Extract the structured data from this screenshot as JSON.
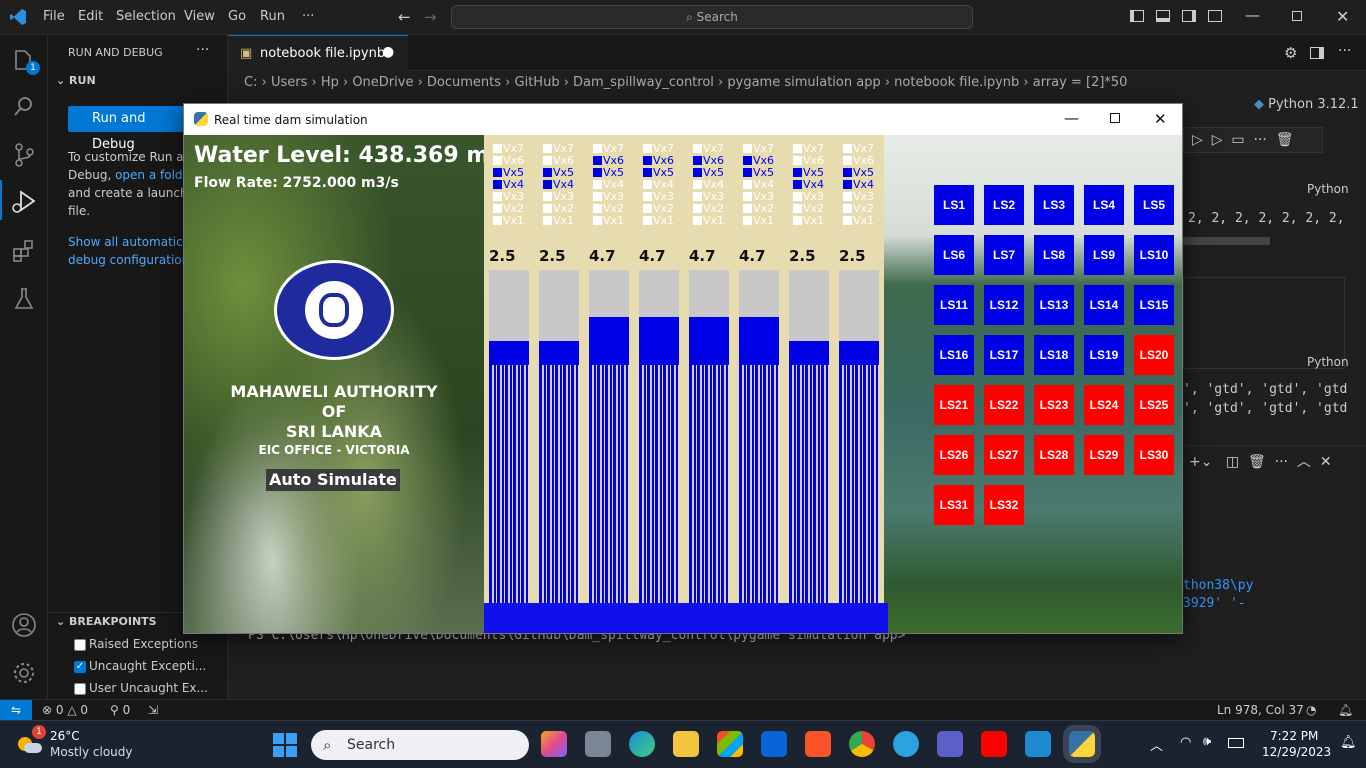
{
  "menu": {
    "file": "File",
    "edit": "Edit",
    "selection": "Selection",
    "view": "View",
    "go": "Go",
    "run": "Run",
    "more": "···",
    "search": "Search"
  },
  "sidebar": {
    "title": "RUN AND DEBUG",
    "section_run": "RUN",
    "run_button": "Run and Debug",
    "help_l1": "To customize Run ar",
    "help_l2a": "Debug, ",
    "help_l2_link": "open a folde",
    "help_l3": "and create a launch.",
    "help_l4": "file.",
    "show_all_l1": "Show all automatic",
    "show_all_l2": "debug configuration",
    "breakpoints": "BREAKPOINTS",
    "bp_items": [
      {
        "label": "Raised Exceptions",
        "checked": false
      },
      {
        "label": "Uncaught Excepti...",
        "checked": true
      },
      {
        "label": "User Uncaught Ex...",
        "checked": false
      }
    ]
  },
  "editor": {
    "tab_label": "notebook file.ipynb",
    "breadcrumb": [
      "C:",
      "Users",
      "Hp",
      "OneDrive",
      "Documents",
      "GitHub",
      "Dam_spillway_control",
      "pygame simulation app",
      "notebook file.ipynb",
      "array = [2]*50"
    ],
    "kernel": "Python 3.12.1",
    "cell_lang1": "Python",
    "output_row": "2, 2, 2, 2, 2, 2, 2,",
    "cell_lang2": "Python",
    "gtd_row1": "', 'gtd', 'gtd', 'gtd",
    "gtd_row2": "', 'gtd', 'gtd', 'gtd",
    "term_r1": "thon38\\py",
    "term_r2": "3929' '-",
    "prompt": "PS C:\\Users\\Hp\\OneDrive\\Documents\\GitHub\\Dam_spillway_control\\pygame simulation app>"
  },
  "status": {
    "errors": "0",
    "warnings": "0",
    "ports": "0",
    "cursor": "Ln 978, Col 37"
  },
  "taskbar": {
    "temp": "26°C",
    "weather": "Mostly cloudy",
    "badge": "1",
    "search": "Search",
    "time": "7:22 PM",
    "date": "12/29/2023"
  },
  "sim": {
    "window_title": "Real time dam simulation",
    "water_level": "Water Level: 438.369 m",
    "flow_rate": "Flow Rate: 2752.000 m3/s",
    "org_l1": "MAHAWELI AUTHORITY",
    "org_l2": "OF",
    "org_l3": "SRI LANKA",
    "org_l4": "EIC OFFICE - VICTORIA",
    "auto_button": "Auto Simulate",
    "gates": [
      {
        "opening": "2.5",
        "level": 2,
        "vx": [
          false,
          false,
          true,
          true,
          false,
          false,
          false
        ]
      },
      {
        "opening": "2.5",
        "level": 2,
        "vx": [
          false,
          false,
          true,
          true,
          false,
          false,
          false
        ]
      },
      {
        "opening": "4.7",
        "level": 4,
        "vx": [
          false,
          true,
          true,
          false,
          false,
          false,
          false
        ]
      },
      {
        "opening": "4.7",
        "level": 4,
        "vx": [
          false,
          true,
          true,
          false,
          false,
          false,
          false
        ]
      },
      {
        "opening": "4.7",
        "level": 4,
        "vx": [
          false,
          true,
          true,
          false,
          false,
          false,
          false
        ]
      },
      {
        "opening": "4.7",
        "level": 4,
        "vx": [
          false,
          true,
          true,
          false,
          false,
          false,
          false
        ]
      },
      {
        "opening": "2.5",
        "level": 2,
        "vx": [
          false,
          false,
          true,
          true,
          false,
          false,
          false
        ]
      },
      {
        "opening": "2.5",
        "level": 2,
        "vx": [
          false,
          false,
          true,
          true,
          false,
          false,
          false
        ]
      }
    ],
    "vx_labels": [
      "Vx7",
      "Vx6",
      "Vx5",
      "Vx4",
      "Vx3",
      "Vx2",
      "Vx1"
    ],
    "ls": [
      {
        "label": "LS1",
        "state": "blue"
      },
      {
        "label": "LS2",
        "state": "blue"
      },
      {
        "label": "LS3",
        "state": "blue"
      },
      {
        "label": "LS4",
        "state": "blue"
      },
      {
        "label": "LS5",
        "state": "blue"
      },
      {
        "label": "LS6",
        "state": "blue"
      },
      {
        "label": "LS7",
        "state": "blue"
      },
      {
        "label": "LS8",
        "state": "blue"
      },
      {
        "label": "LS9",
        "state": "blue"
      },
      {
        "label": "LS10",
        "state": "blue"
      },
      {
        "label": "LS11",
        "state": "blue"
      },
      {
        "label": "LS12",
        "state": "blue"
      },
      {
        "label": "LS13",
        "state": "blue"
      },
      {
        "label": "LS14",
        "state": "blue"
      },
      {
        "label": "LS15",
        "state": "blue"
      },
      {
        "label": "LS16",
        "state": "blue"
      },
      {
        "label": "LS17",
        "state": "blue"
      },
      {
        "label": "LS18",
        "state": "blue"
      },
      {
        "label": "LS19",
        "state": "blue"
      },
      {
        "label": "LS20",
        "state": "red"
      },
      {
        "label": "LS21",
        "state": "red"
      },
      {
        "label": "LS22",
        "state": "red"
      },
      {
        "label": "LS23",
        "state": "red"
      },
      {
        "label": "LS24",
        "state": "red"
      },
      {
        "label": "LS25",
        "state": "red"
      },
      {
        "label": "LS26",
        "state": "red"
      },
      {
        "label": "LS27",
        "state": "red"
      },
      {
        "label": "LS28",
        "state": "red"
      },
      {
        "label": "LS29",
        "state": "red"
      },
      {
        "label": "LS30",
        "state": "red"
      },
      {
        "label": "LS31",
        "state": "red"
      },
      {
        "label": "LS32",
        "state": "red"
      }
    ]
  },
  "colors": {
    "accent": "#0078d4",
    "gate_blue": "#0000e6",
    "ls_red": "#ff0000"
  }
}
